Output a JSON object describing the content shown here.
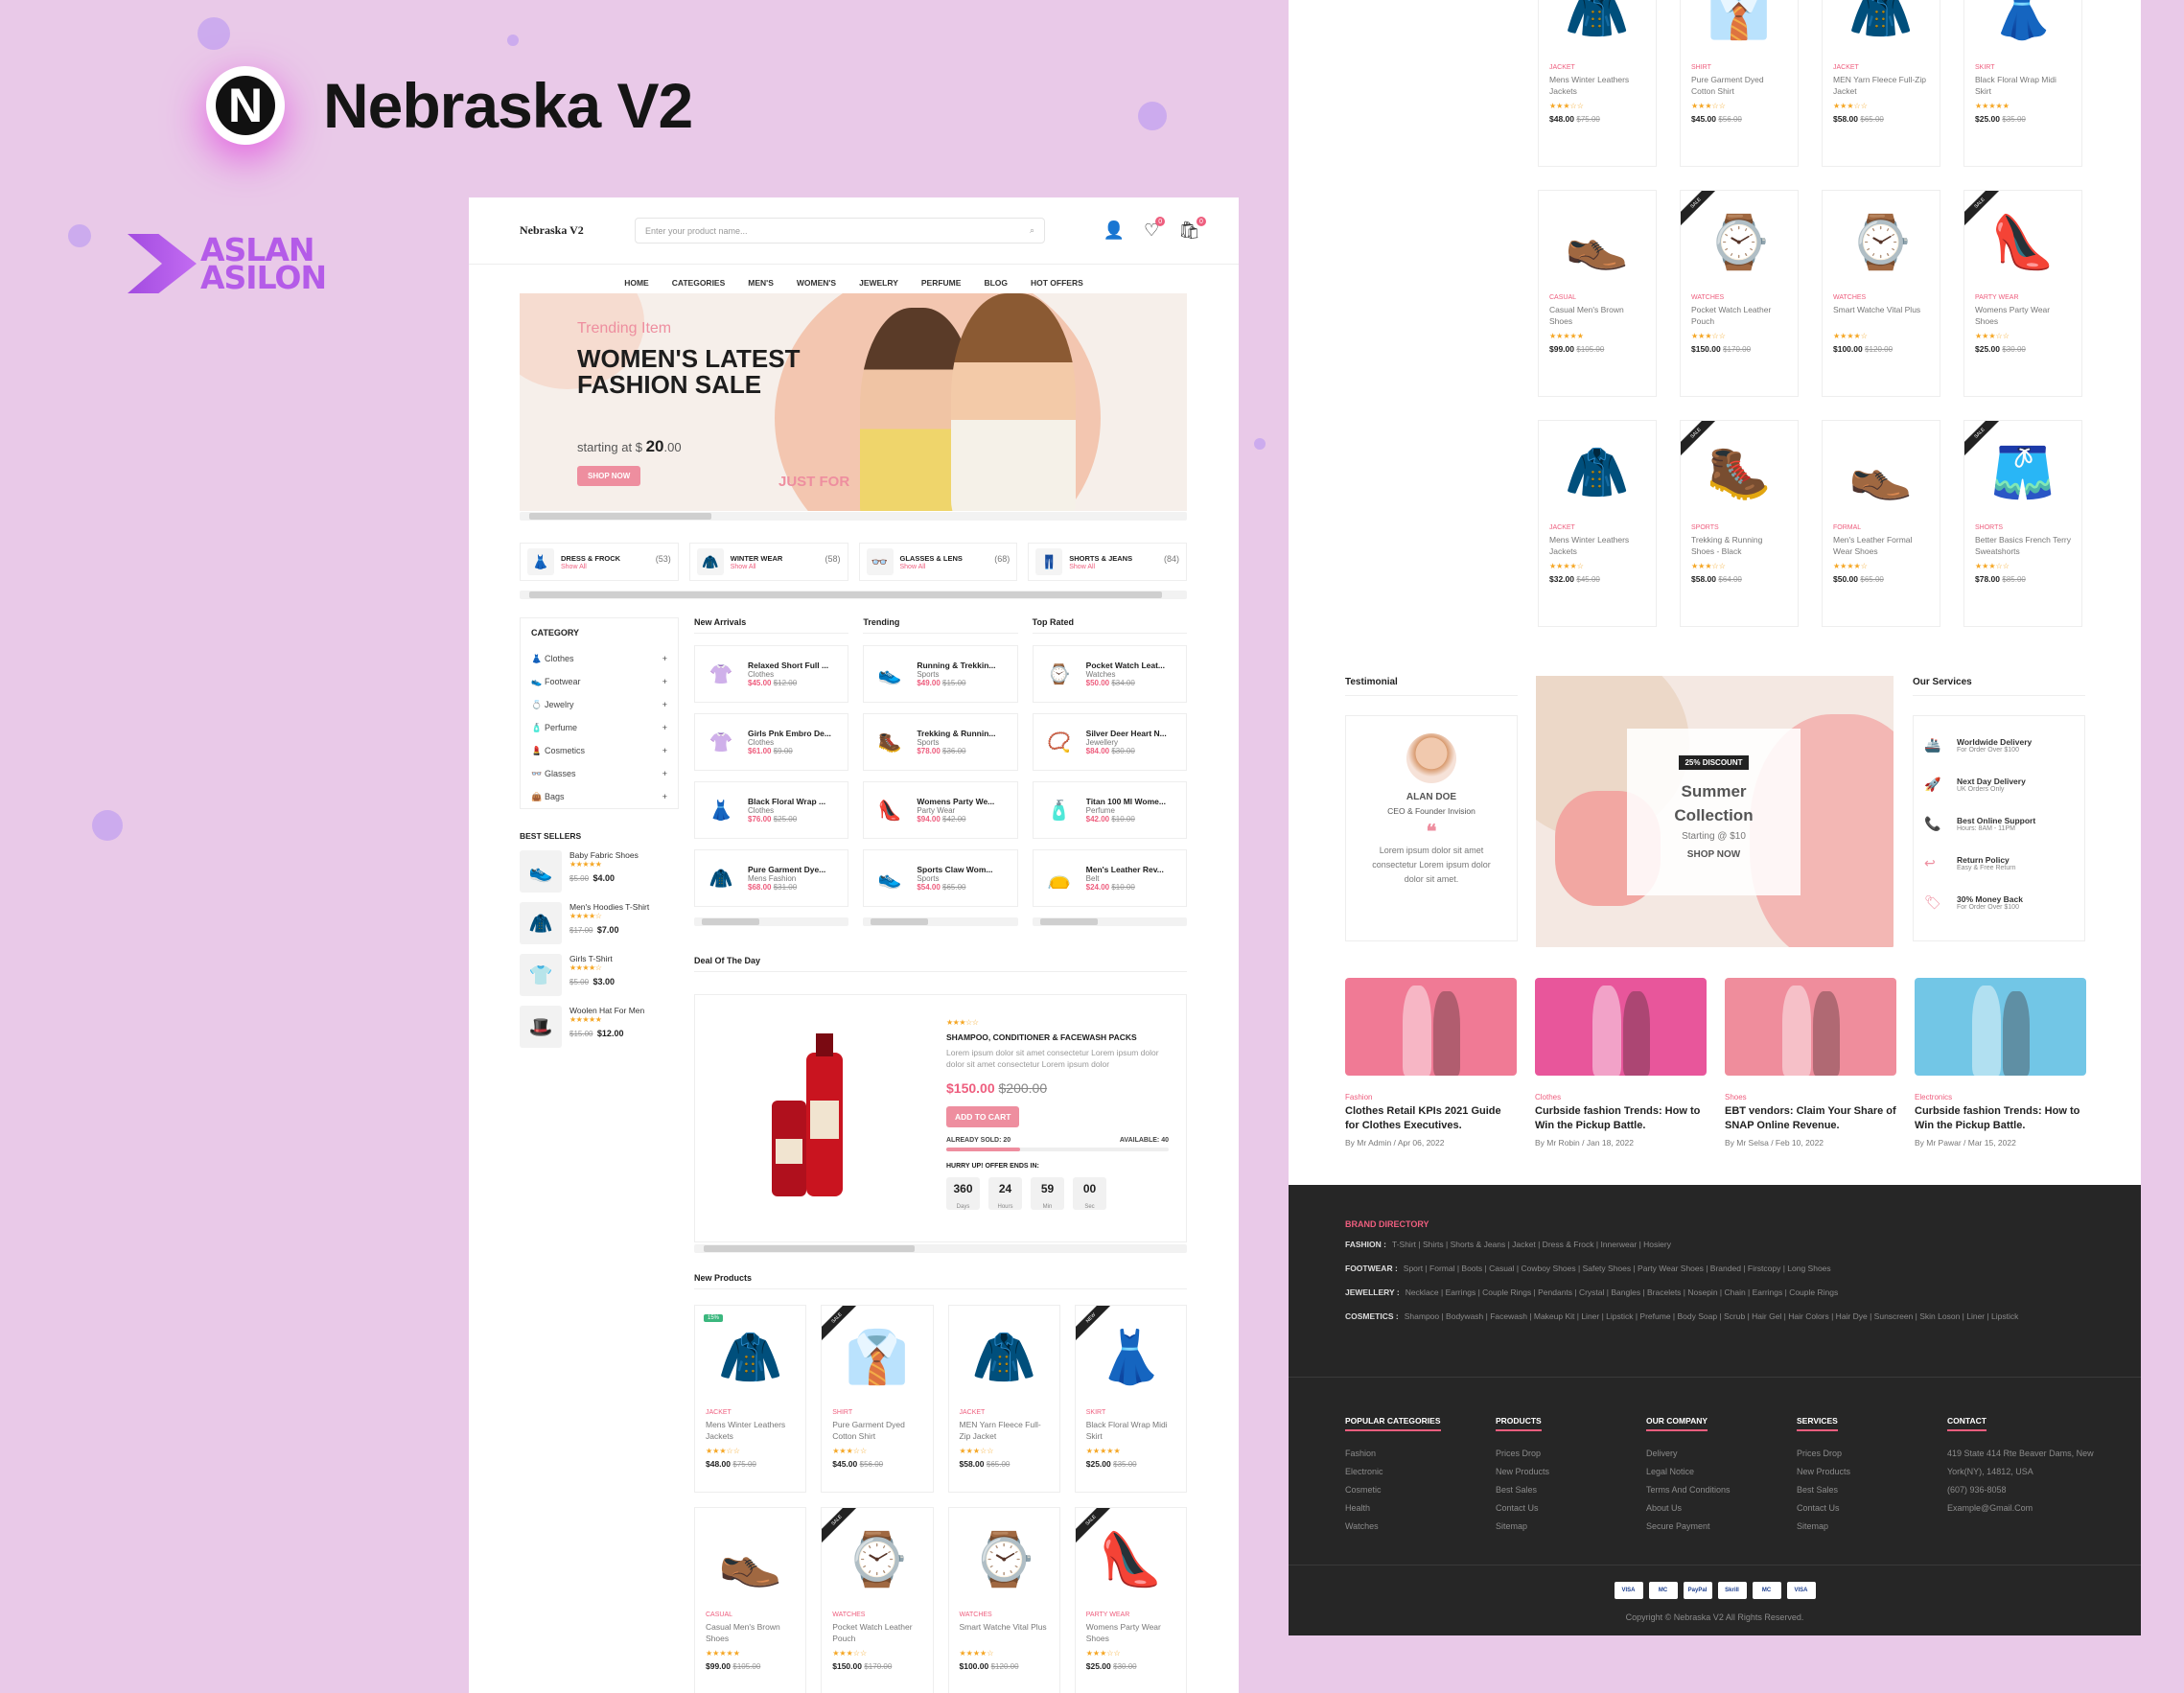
{
  "brand": {
    "title": "Nebraska V2",
    "logo_letter": "N",
    "author_line1": "ASLAN",
    "author_line2": "ASILON"
  },
  "header": {
    "logo": "Nebraska V2",
    "search_placeholder": "Enter your product name...",
    "wishlist_count": "0",
    "cart_count": "0"
  },
  "nav": [
    "HOME",
    "CATEGORIES",
    "MEN'S",
    "WOMEN'S",
    "JEWELRY",
    "PERFUME",
    "BLOG",
    "HOT OFFERS"
  ],
  "hero": {
    "subtitle": "Trending Item",
    "title": "WOMEN'S LATEST FASHION SALE",
    "start_text": "starting at $",
    "price": "20",
    "cents": ".00",
    "button": "SHOP NOW",
    "tag": "JUST FOR"
  },
  "category_cards": [
    {
      "name": "DRESS & FROCK",
      "count": "(53)",
      "link": "Show All",
      "icon": "dress-icon"
    },
    {
      "name": "WINTER WEAR",
      "count": "(58)",
      "link": "Show All",
      "icon": "coat-icon"
    },
    {
      "name": "GLASSES & LENS",
      "count": "(68)",
      "link": "Show All",
      "icon": "glasses-icon"
    },
    {
      "name": "SHORTS & JEANS",
      "count": "(84)",
      "link": "Show All",
      "icon": "shorts-icon"
    }
  ],
  "sidebar": {
    "title": "CATEGORY",
    "items": [
      {
        "label": "Clothes",
        "icon": "👗"
      },
      {
        "label": "Footwear",
        "icon": "👟"
      },
      {
        "label": "Jewelry",
        "icon": "💍"
      },
      {
        "label": "Perfume",
        "icon": "🧴"
      },
      {
        "label": "Cosmetics",
        "icon": "💄"
      },
      {
        "label": "Glasses",
        "icon": "👓"
      },
      {
        "label": "Bags",
        "icon": "👜"
      }
    ],
    "best_title": "BEST SELLERS",
    "best": [
      {
        "name": "Baby Fabric Shoes",
        "old": "$5.00",
        "price": "$4.00",
        "stars": "★★★★★",
        "icon": "👟"
      },
      {
        "name": "Men's Hoodies T-Shirt",
        "old": "$17.00",
        "price": "$7.00",
        "stars": "★★★★☆",
        "icon": "🧥"
      },
      {
        "name": "Girls T-Shirt",
        "old": "$5.00",
        "price": "$3.00",
        "stars": "★★★★☆",
        "icon": "👕"
      },
      {
        "name": "Woolen Hat For Men",
        "old": "$15.00",
        "price": "$12.00",
        "stars": "★★★★★",
        "icon": "🎩"
      }
    ]
  },
  "lists": [
    {
      "title": "New Arrivals",
      "items": [
        {
          "name": "Relaxed Short Full ...",
          "cat": "Clothes",
          "price": "$45.00",
          "old": "$12.00",
          "icon": "👚"
        },
        {
          "name": "Girls Pnk Embro De...",
          "cat": "Clothes",
          "price": "$61.00",
          "old": "$9.00",
          "icon": "👚"
        },
        {
          "name": "Black Floral Wrap ...",
          "cat": "Clothes",
          "price": "$76.00",
          "old": "$25.00",
          "icon": "👗"
        },
        {
          "name": "Pure Garment Dye...",
          "cat": "Mens Fashion",
          "price": "$68.00",
          "old": "$31.00",
          "icon": "🧥"
        }
      ]
    },
    {
      "title": "Trending",
      "items": [
        {
          "name": "Running & Trekkin...",
          "cat": "Sports",
          "price": "$49.00",
          "old": "$15.00",
          "icon": "👟"
        },
        {
          "name": "Trekking & Runnin...",
          "cat": "Sports",
          "price": "$78.00",
          "old": "$36.00",
          "icon": "🥾"
        },
        {
          "name": "Womens Party We...",
          "cat": "Party Wear",
          "price": "$94.00",
          "old": "$42.00",
          "icon": "👠"
        },
        {
          "name": "Sports Claw Wom...",
          "cat": "Sports",
          "price": "$54.00",
          "old": "$65.00",
          "icon": "👟"
        }
      ]
    },
    {
      "title": "Top Rated",
      "items": [
        {
          "name": "Pocket Watch Leat...",
          "cat": "Watches",
          "price": "$50.00",
          "old": "$34.00",
          "icon": "⌚"
        },
        {
          "name": "Silver Deer Heart N...",
          "cat": "Jewellery",
          "price": "$84.00",
          "old": "$30.00",
          "icon": "📿"
        },
        {
          "name": "Titan 100 Ml Wome...",
          "cat": "Perfume",
          "price": "$42.00",
          "old": "$10.00",
          "icon": "🧴"
        },
        {
          "name": "Men's Leather Rev...",
          "cat": "Belt",
          "price": "$24.00",
          "old": "$10.00",
          "icon": "👝"
        }
      ]
    }
  ],
  "deal": {
    "section_title": "Deal Of The Day",
    "stars": "★★★☆☆",
    "title": "SHAMPOO, CONDITIONER & FACEWASH PACKS",
    "desc": "Lorem ipsum dolor sit amet consectetur Lorem ipsum dolor dolor sit amet consectetur Lorem ipsum dolor",
    "price": "$150.00",
    "old": "$200.00",
    "button": "ADD TO CART",
    "sold_label": "ALREADY SOLD:",
    "sold": "20",
    "avail_label": "AVAILABLE:",
    "available": "40",
    "sold_fraction": 0.33,
    "hurry": "HURRY UP! OFFER ENDS IN:",
    "countdown": [
      {
        "v": "360",
        "l": "Days"
      },
      {
        "v": "24",
        "l": "Hours"
      },
      {
        "v": "59",
        "l": "Min"
      },
      {
        "v": "00",
        "l": "Sec"
      }
    ]
  },
  "new_products_title": "New Products",
  "products": [
    {
      "cat": "JACKET",
      "name": "Mens Winter Leathers Jackets",
      "stars": "★★★☆☆",
      "price": "$48.00",
      "old": "$75.00",
      "badge": "15%",
      "icon": "🧥",
      "bg": "#f2f2f2"
    },
    {
      "cat": "SHIRT",
      "name": "Pure Garment Dyed Cotton Shirt",
      "stars": "★★★☆☆",
      "price": "$45.00",
      "old": "$56.00",
      "badge": "SALE",
      "icon": "👔",
      "bg": "#f2f2f2"
    },
    {
      "cat": "JACKET",
      "name": "MEN Yarn Fleece Full-Zip Jacket",
      "stars": "★★★☆☆",
      "price": "$58.00",
      "old": "$65.00",
      "badge": "",
      "icon": "🧥",
      "bg": "#f2f2f2"
    },
    {
      "cat": "SKIRT",
      "name": "Black Floral Wrap Midi Skirt",
      "stars": "★★★★★",
      "price": "$25.00",
      "old": "$35.00",
      "badge": "NEW",
      "icon": "👗",
      "bg": "#f2f2f2"
    },
    {
      "cat": "CASUAL",
      "name": "Casual Men's Brown Shoes",
      "stars": "★★★★★",
      "price": "$99.00",
      "old": "$105.00",
      "badge": "",
      "icon": "👞",
      "bg": "#f2f2f2"
    },
    {
      "cat": "WATCHES",
      "name": "Pocket Watch Leather Pouch",
      "stars": "★★★☆☆",
      "price": "$150.00",
      "old": "$170.00",
      "badge": "SALE",
      "icon": "⌚",
      "bg": "#f2f2f2"
    },
    {
      "cat": "WATCHES",
      "name": "Smart Watche Vital Plus",
      "stars": "★★★★☆",
      "price": "$100.00",
      "old": "$120.00",
      "badge": "",
      "icon": "⌚",
      "bg": "#f2f2f2"
    },
    {
      "cat": "PARTY WEAR",
      "name": "Womens Party Wear Shoes",
      "stars": "★★★☆☆",
      "price": "$25.00",
      "old": "$30.00",
      "badge": "SALE",
      "icon": "👠",
      "bg": "#f2f2f2"
    },
    {
      "cat": "JACKET",
      "name": "Mens Winter Leathers Jackets",
      "stars": "★★★★☆",
      "price": "$32.00",
      "old": "$45.00",
      "badge": "",
      "icon": "🧥",
      "bg": "#f2f2f2"
    },
    {
      "cat": "SPORTS",
      "name": "Trekking & Running Shoes - Black",
      "stars": "★★★☆☆",
      "price": "$58.00",
      "old": "$64.00",
      "badge": "SALE",
      "icon": "🥾",
      "bg": "#f2f2f2"
    },
    {
      "cat": "FORMAL",
      "name": "Men's Leather Formal Wear Shoes",
      "stars": "★★★★☆",
      "price": "$50.00",
      "old": "$65.00",
      "badge": "",
      "icon": "👞",
      "bg": "#f2f2f2"
    },
    {
      "cat": "SHORTS",
      "name": "Better Basics French Terry Sweatshorts",
      "stars": "★★★☆☆",
      "price": "$78.00",
      "old": "$85.00",
      "badge": "SALE",
      "icon": "🩳",
      "bg": "#f2f2f2"
    }
  ],
  "testimonial": {
    "title": "Testimonial",
    "name": "ALAN DOE",
    "role": "CEO & Founder Invision",
    "quote": "Lorem ipsum dolor sit amet consectetur Lorem ipsum dolor dolor sit amet."
  },
  "summer": {
    "badge": "25% DISCOUNT",
    "title": "Summer Collection",
    "start": "Starting @ $10",
    "button": "SHOP NOW"
  },
  "services": {
    "title": "Our Services",
    "items": [
      {
        "t": "Worldwide Delivery",
        "s": "For Order Over $100",
        "icon": "🚢"
      },
      {
        "t": "Next Day Delivery",
        "s": "UK Orders Only",
        "icon": "🚀"
      },
      {
        "t": "Best Online Support",
        "s": "Hours: 8AM - 11PM",
        "icon": "📞"
      },
      {
        "t": "Return Policy",
        "s": "Easy & Free Return",
        "icon": "↩"
      },
      {
        "t": "30% Money Back",
        "s": "For Order Over $100",
        "icon": "🏷"
      }
    ]
  },
  "blogs": [
    {
      "cat": "Fashion",
      "title": "Clothes Retail KPIs 2021 Guide for Clothes Executives.",
      "author": "Mr Admin",
      "date": "Apr 06, 2022",
      "color": "#f07a95"
    },
    {
      "cat": "Clothes",
      "title": "Curbside fashion Trends: How to Win the Pickup Battle.",
      "author": "Mr Robin",
      "date": "Jan 18, 2022",
      "color": "#e8569b"
    },
    {
      "cat": "Shoes",
      "title": "EBT vendors: Claim Your Share of SNAP Online Revenue.",
      "author": "Mr Selsa",
      "date": "Feb 10, 2022",
      "color": "#ef8d9c"
    },
    {
      "cat": "Electronics",
      "title": "Curbside fashion Trends: How to Win the Pickup Battle.",
      "author": "Mr Pawar",
      "date": "Mar 15, 2022",
      "color": "#72c6e6"
    }
  ],
  "footer": {
    "directory_title": "BRAND DIRECTORY",
    "rows": [
      {
        "k": "FASHION :",
        "v": "T-Shirt | Shirts | Shorts & Jeans | Jacket | Dress & Frock | Innerwear | Hosiery"
      },
      {
        "k": "FOOTWEAR :",
        "v": "Sport | Formal | Boots | Casual | Cowboy Shoes | Safety Shoes | Party Wear Shoes | Branded | Firstcopy | Long Shoes"
      },
      {
        "k": "JEWELLERY :",
        "v": "Necklace | Earrings | Couple Rings | Pendants | Crystal | Bangles | Bracelets | Nosepin | Chain | Earrings | Couple Rings"
      },
      {
        "k": "COSMETICS :",
        "v": "Shampoo | Bodywash | Facewash | Makeup Kit | Liner | Lipstick | Prefume | Body Soap | Scrub | Hair Gel | Hair Colors | Hair Dye | Sunscreen | Skin Loson | Liner | Lipstick"
      }
    ],
    "columns": [
      {
        "title": "POPULAR CATEGORIES",
        "items": [
          "Fashion",
          "Electronic",
          "Cosmetic",
          "Health",
          "Watches"
        ]
      },
      {
        "title": "PRODUCTS",
        "items": [
          "Prices Drop",
          "New Products",
          "Best Sales",
          "Contact Us",
          "Sitemap"
        ]
      },
      {
        "title": "OUR COMPANY",
        "items": [
          "Delivery",
          "Legal Notice",
          "Terms And Conditions",
          "About Us",
          "Secure Payment"
        ]
      },
      {
        "title": "SERVICES",
        "items": [
          "Prices Drop",
          "New Products",
          "Best Sales",
          "Contact Us",
          "Sitemap"
        ]
      },
      {
        "title": "CONTACT",
        "items": [
          "419 State 414 Rte Beaver Dams, New York(NY), 14812, USA",
          "(607) 936-8058",
          "Example@Gmail.Com"
        ]
      }
    ],
    "payments": [
      "VISA",
      "MC",
      "PayPal",
      "Skrill",
      "MC",
      "VISA"
    ],
    "copyright": "Copyright © Nebraska V2 All Rights Reserved."
  }
}
